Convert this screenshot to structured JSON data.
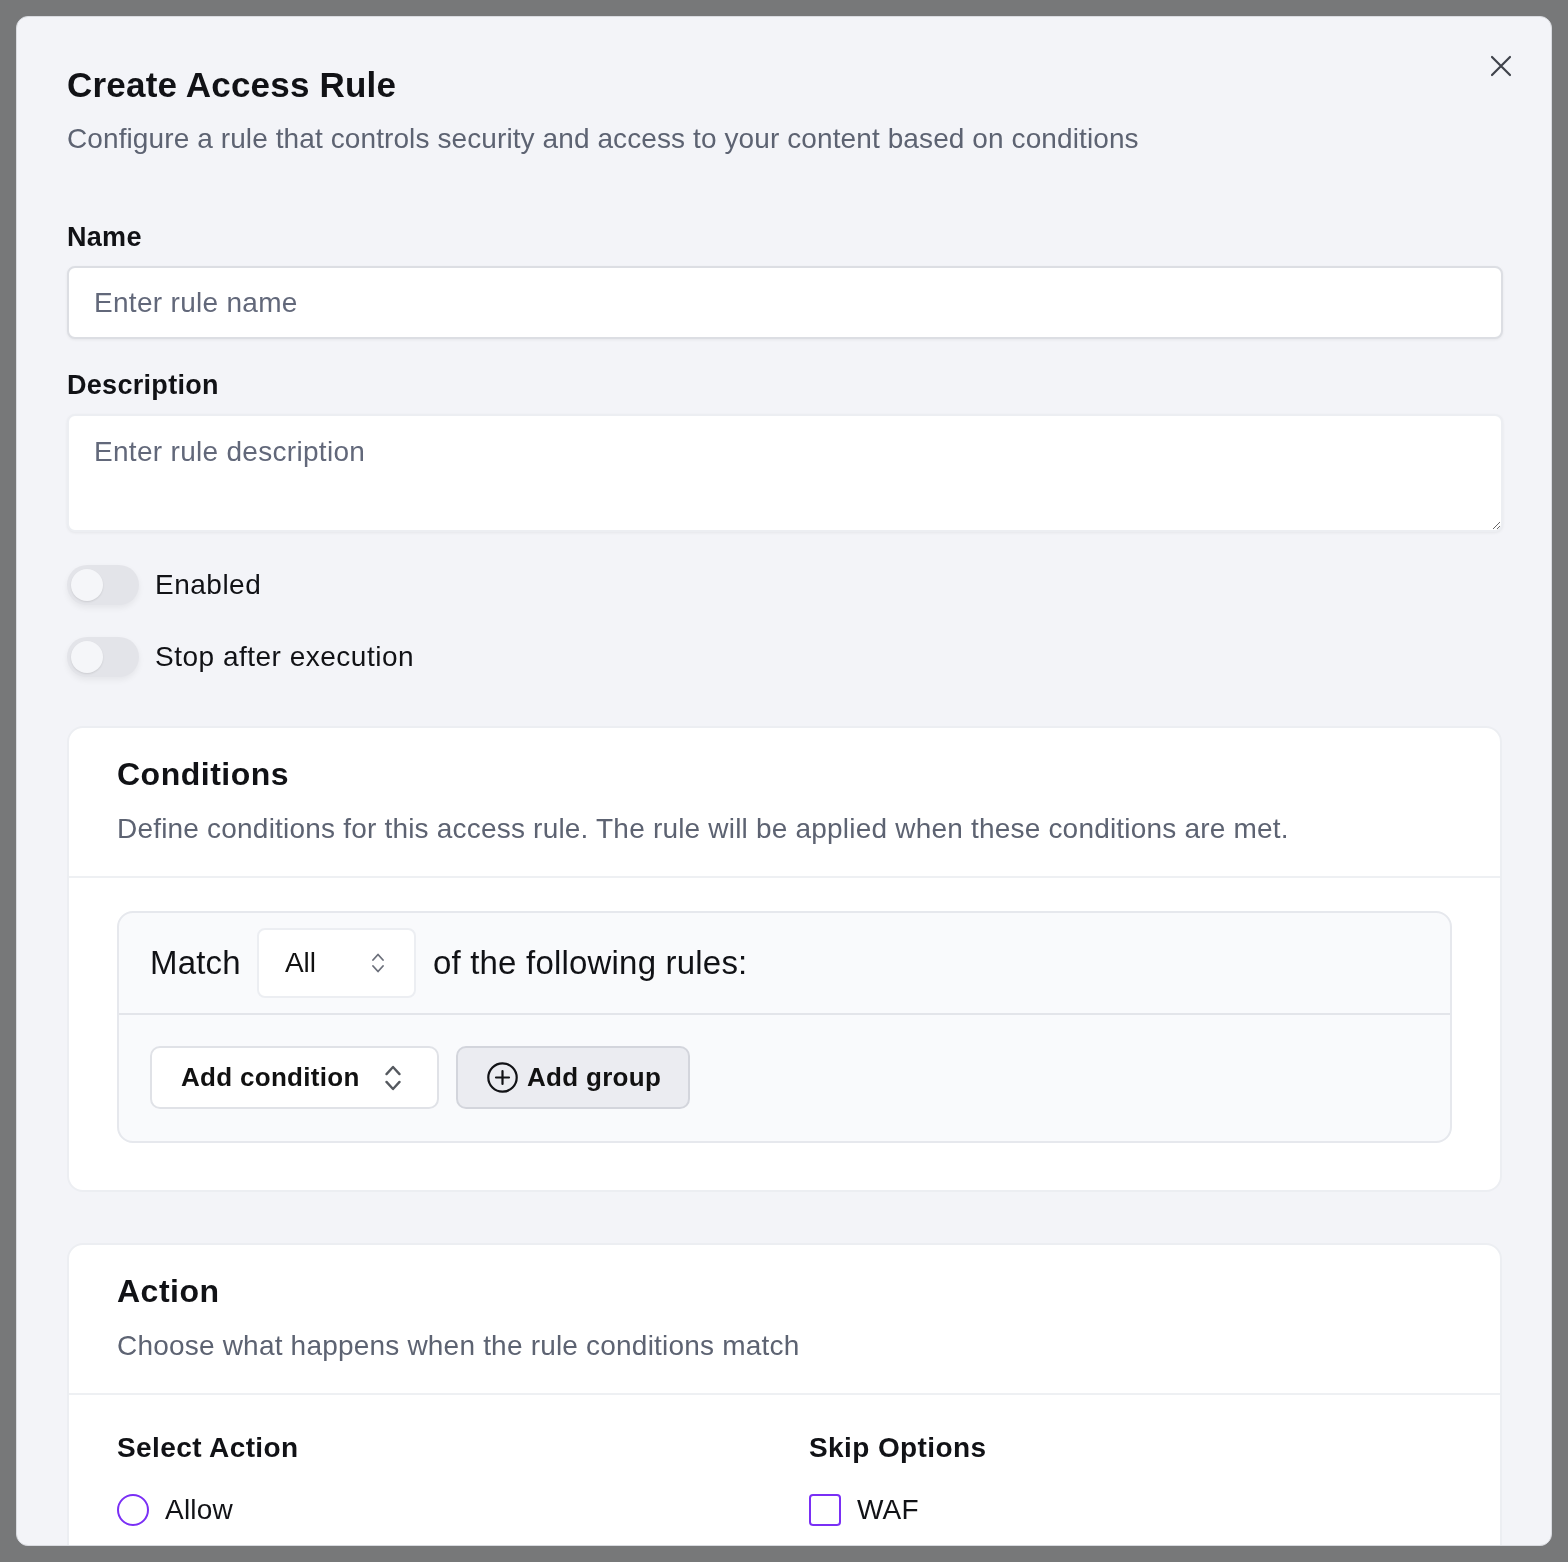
{
  "dialog": {
    "title": "Create Access Rule",
    "subtitle": "Configure a rule that controls security and access to your content based on conditions"
  },
  "fields": [
    {
      "kind": "input",
      "label": "Name",
      "placeholder": "Enter rule name"
    },
    {
      "kind": "textarea",
      "label": "Description",
      "placeholder": "Enter rule description"
    }
  ],
  "toggles": [
    {
      "label": "Enabled",
      "on": false
    },
    {
      "label": "Stop after execution",
      "on": false
    }
  ],
  "conditions": {
    "title": "Conditions",
    "description": "Define conditions for this access rule. The rule will be applied when these conditions are met.",
    "match_prefix": "Match",
    "match_select": {
      "value": "All"
    },
    "match_suffix": "of the following rules:",
    "add_condition": {
      "label": "Add condition"
    },
    "add_group": {
      "label": "Add group"
    }
  },
  "action": {
    "title": "Action",
    "description": "Choose what happens when the rule conditions match",
    "select_action": {
      "label": "Select Action",
      "options": [
        {
          "label": "Allow",
          "selected": false
        }
      ]
    },
    "skip_options": {
      "label": "Skip Options",
      "options": [
        {
          "label": "WAF",
          "checked": false
        }
      ]
    }
  }
}
